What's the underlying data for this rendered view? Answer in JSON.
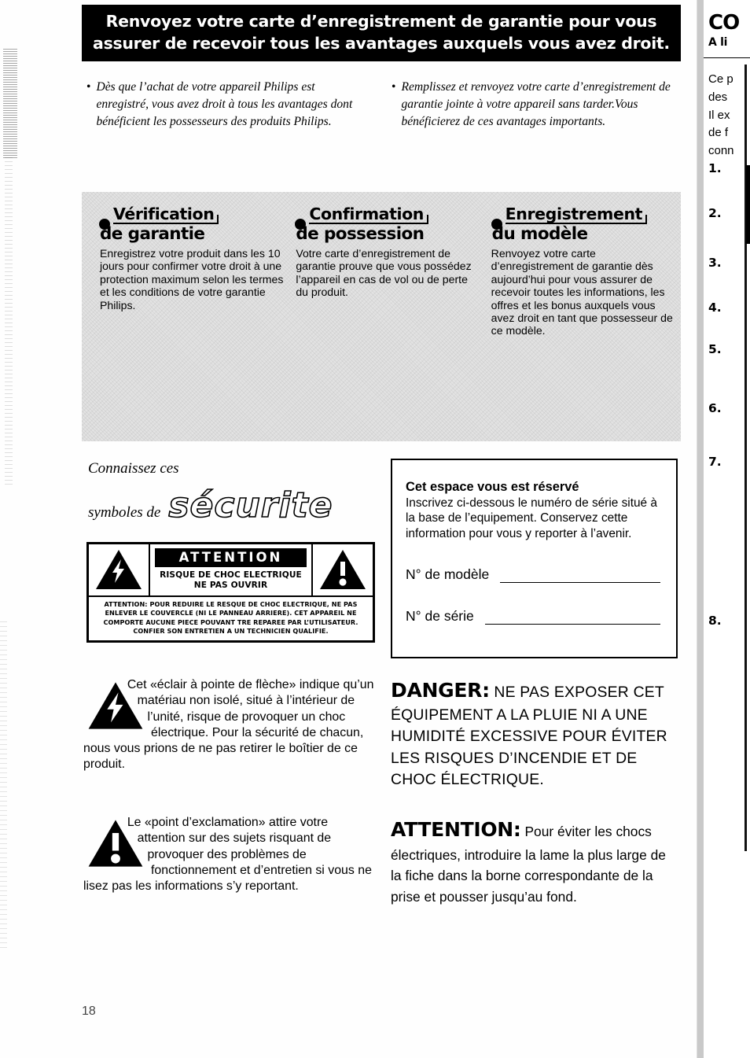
{
  "banner": {
    "text": "Renvoyez votre carte d’enregistrement de garantie pour vous assurer de recevoir tous les avantages auxquels vous avez droit."
  },
  "bullets": [
    {
      "marker": "•",
      "text": "Dès que l’achat de votre appareil Philips est enregistré, vous avez droit à tous les avantages dont bénéficient les possesseurs des produits Philips."
    },
    {
      "marker": "•",
      "text": "Remplissez et renvoyez votre carte d’enregistrement de garantie jointe à votre appareil sans tarder.Vous bénéficierez de ces avantages importants."
    }
  ],
  "panel": {
    "columns": [
      {
        "heading_line1": "Vérification",
        "heading_line2": "de garantie",
        "body": "Enregistrez votre produit dans les 10 jours pour confirmer votre droit à une protection maximum selon les termes et les conditions de votre garantie Philips."
      },
      {
        "heading_line1": "Confirmation",
        "heading_line2": "de possession",
        "body": "Votre carte d’enregistrement de garantie prouve que vous possédez l’appareil en cas de vol ou de perte du produit."
      },
      {
        "heading_line1": "Enregistrement",
        "heading_line2": "du modèle",
        "body": "Renvoyez votre carte d’enregistrement de garantie dès aujourd’hui pour vous assurer de recevoir toutes les informations, les offres et les bonus auxquels vous avez droit en tant que possesseur de ce modèle."
      }
    ]
  },
  "symbols_heading": {
    "line1": "Connaissez ces",
    "line2_prefix": "symboles de",
    "line2_outline": "sécurite"
  },
  "warning_box": {
    "title": "ATTENTION",
    "subtitle_line1": "RISQUE DE CHOC ELECTRIQUE",
    "subtitle_line2": "NE PAS OUVRIR",
    "footer": "ATTENTION: POUR REDUIRE LE RESQUE DE CHOC ELECTRIQUE, NE PAS ENLEVER LE COUVERCLE (NI LE PANNEAU ARRIERE). CET APPAREIL NE COMPORTE AUCUNE PIECE POUVANT TRE REPAREE PAR L’UTILISATEUR. CONFIER SON ENTRETIEN A UN TECHNICIEN QUALIFIE.",
    "left_icon": "lightning-bolt-triangle-icon",
    "right_icon": "exclamation-triangle-icon"
  },
  "reserved_box": {
    "title": "Cet espace vous est réservé",
    "body": "Inscrivez ci-dessous le numéro de série situé à la base de l’equipement. Conservez cette information pour vous y reporter à l’avenir.",
    "fields": [
      {
        "label": "N° de modèle",
        "value": ""
      },
      {
        "label": "N° de série",
        "value": ""
      }
    ]
  },
  "paragraphs": [
    {
      "icon": "lightning-bolt-triangle-icon",
      "text": "Cet «éclair à pointe de flèche» indique qu’un matériau non isolé, situé à l’intérieur de l’unité, risque de provoquer un choc électrique. Pour la sécurité de chacun, nous vous prions de ne pas retirer le boîtier de ce produit."
    },
    {
      "icon": "exclamation-triangle-icon",
      "text": "Le «point d’exclamation» attire votre attention sur des sujets risquant de provoquer des problèmes de fonctionnement et d’entretien si vous ne lisez pas les informations s’y reportant."
    }
  ],
  "notes": [
    {
      "head": "DANGER:",
      "body": " NE PAS EXPOSER CET ÉQUIPEMENT A LA PLUIE NI A UNE HUMIDITÉ EXCESSIVE POUR ÉVITER LES RISQUES D’INCENDIE ET DE CHOC ÉLECTRIQUE."
    },
    {
      "head": "ATTENTION:",
      "body": " Pour éviter les chocs électriques, introduire la lame la plus large de la fiche dans la borne correspondante de la prise et pousser jusqu’au fond."
    }
  ],
  "page_number": "18",
  "edge_page": {
    "title": "CO",
    "subtitle": "A li",
    "lines": "Ce p\ndes \nIl ex\nde f\nconn",
    "numbers": [
      "1.",
      "2.",
      "3.",
      "4.",
      "5.",
      "6.",
      "7.",
      "8."
    ]
  },
  "colors": {
    "ink": "#000000",
    "paper": "#fefefe",
    "panel_gray": "#e3e3e3"
  }
}
